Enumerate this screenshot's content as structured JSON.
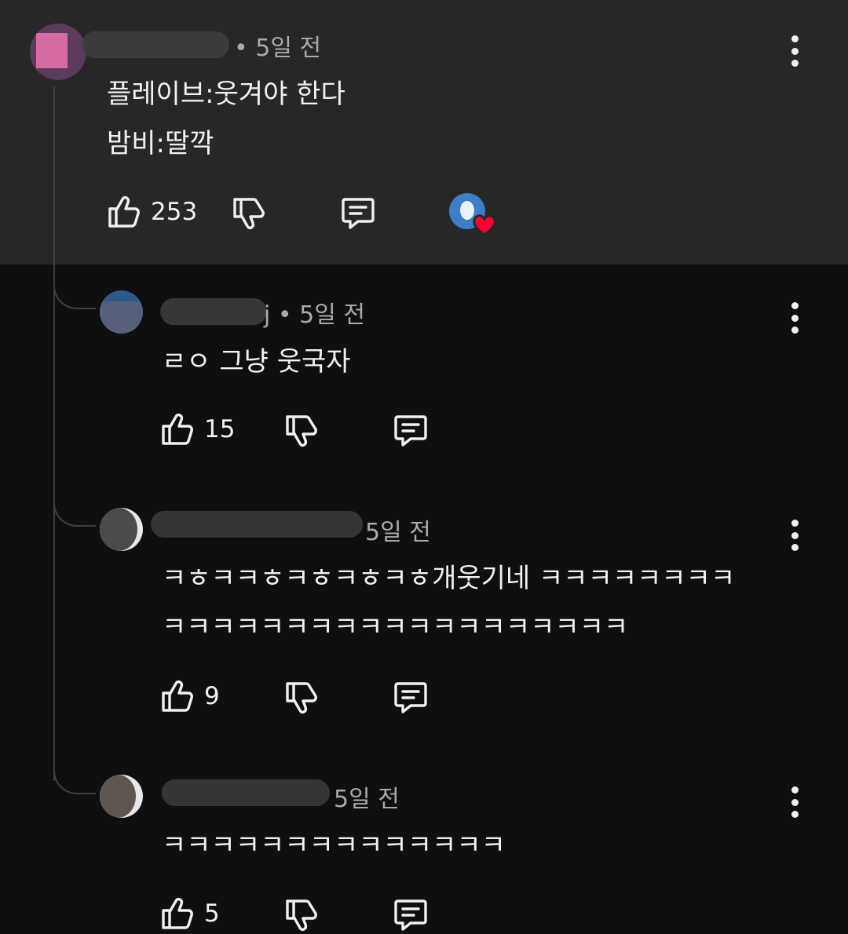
{
  "comment": {
    "meta": "• 5일 전",
    "lines": [
      "플레이브:웃겨야 한다",
      "밤비:딸깍"
    ],
    "likes": "253"
  },
  "replies": [
    {
      "meta": "j • 5일 전",
      "lines": [
        "ㄹㅇ 그냥 웃국자"
      ],
      "likes": "15"
    },
    {
      "meta": "5일 전",
      "lines": [
        "ㅋㅎㅋㅋㅎㅋㅎㅋㅎㅋㅎ개웃기네 ㅋㅋㅋㅋㅋㅋㅋㅋ",
        "ㅋㅋㅋㅋㅋㅋㅋㅋㅋㅋㅋㅋㅋㅋㅋㅋㅋㅋㅋ"
      ],
      "likes": "9"
    },
    {
      "meta": "5일 전",
      "lines": [
        "ㅋㅋㅋㅋㅋㅋㅋㅋㅋㅋㅋㅋㅋㅋ"
      ],
      "likes": "5"
    }
  ],
  "colors": {
    "panel": "#272727",
    "background": "#0f0f0f",
    "heart": "#ff0033"
  },
  "icons": [
    "thumb-up-icon",
    "thumb-down-icon",
    "reply-icon",
    "more-vert-icon",
    "heart-icon"
  ]
}
